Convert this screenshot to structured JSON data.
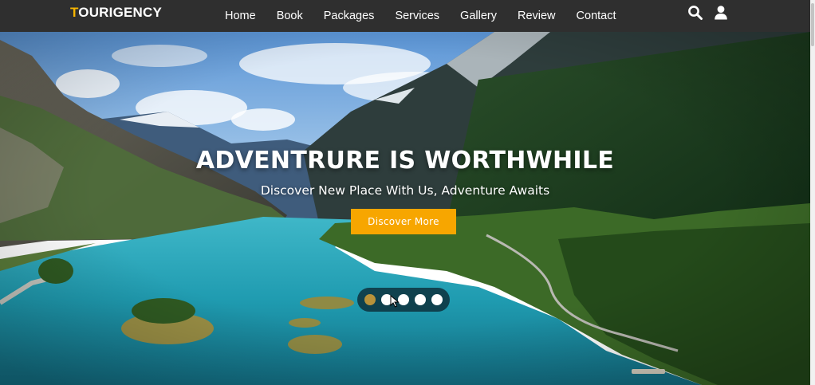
{
  "brand": {
    "first_letter": "T",
    "rest": "OURIGENCY"
  },
  "nav": {
    "links": [
      "Home",
      "Book",
      "Packages",
      "Services",
      "Gallery",
      "Review",
      "Contact"
    ],
    "icons": [
      "search-icon",
      "user-icon"
    ]
  },
  "hero": {
    "title": "ADVENTRURE IS WORTHWHILE",
    "subtitle": "Discover New Place With Us, Adventure Awaits",
    "button_label": "Discover More",
    "slides": {
      "count": 5,
      "active": 1
    }
  },
  "colors": {
    "nav_background": "#2f2f2f",
    "brand_accent": "#f5b400",
    "button": "#f7a600",
    "active_dot": "#b8923a",
    "water": "#1f9bb0"
  }
}
